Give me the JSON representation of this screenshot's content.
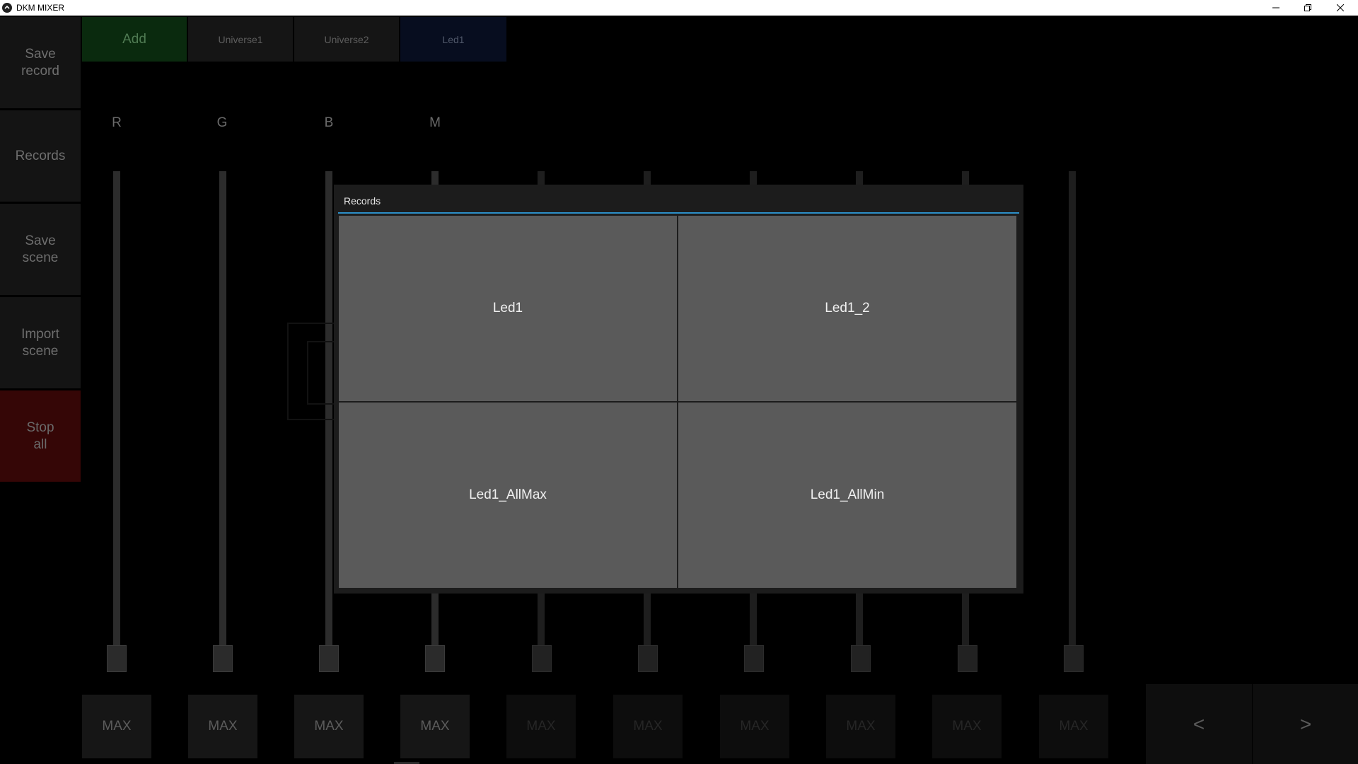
{
  "window": {
    "title": "DKM MIXER",
    "icon": "dkm-logo-icon",
    "controls": [
      "minimize-icon",
      "restore-icon",
      "close-icon"
    ]
  },
  "sidebar": {
    "save_record": "Save\nrecord",
    "records": "Records",
    "save_scene": "Save\nscene",
    "import_scene": "Import\nscene",
    "stop_all": "Stop\nall"
  },
  "tabs": {
    "add": "Add",
    "universe1": "Universe1",
    "universe2": "Universe2",
    "led1": "Led1"
  },
  "channels": {
    "labels": [
      "R",
      "G",
      "B",
      "M"
    ],
    "max_label": "MAX"
  },
  "nav": {
    "prev": "<",
    "next": ">"
  },
  "dialog": {
    "title": "Records",
    "items": [
      "Led1",
      "Led1_2",
      "Led1_AllMax",
      "Led1_AllMin"
    ]
  },
  "colors": {
    "accent": "#2d8fc8",
    "add_tab": "#0a2a0e",
    "stop_all": "#350606",
    "record_tile": "#5a5a5a"
  }
}
